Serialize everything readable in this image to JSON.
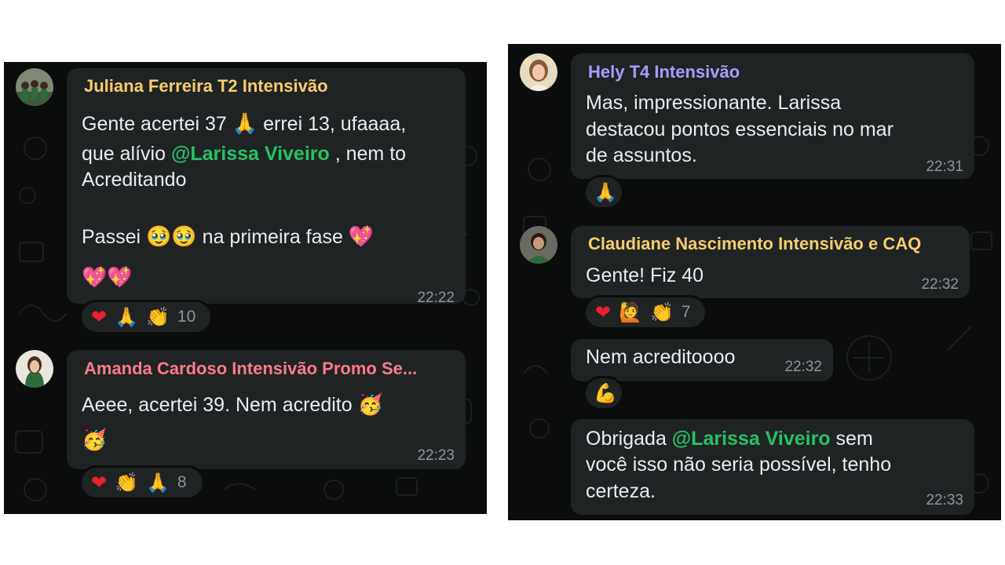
{
  "left_panel": {
    "messages": [
      {
        "sender": "Juliana Ferreira T2 Intensivão",
        "sender_color": "#f8cd6a",
        "line1_a": "Gente acertei 37 ",
        "line1_emoji": "🙏",
        "line1_b": " errei 13,  ufaaaa,",
        "line2_a": "que alívio ",
        "mention": "@Larissa Viveiro",
        "line2_b": " , nem to",
        "line3": "Acreditando",
        "line4_a": "Passei ",
        "line4_emoji": "🥹🥹",
        "line4_b": " na primeira fase ",
        "line4_emoji2": "💖",
        "line5_emoji": "💖💖",
        "time": "22:22",
        "reactions": [
          "❤",
          "🙏",
          "👏"
        ],
        "reaction_count": "10"
      },
      {
        "sender": "Amanda Cardoso Intensivão Promo Se...",
        "sender_color": "#fd7b8a",
        "line1_a": "Aeee, acertei 39. Nem acredito ",
        "line1_emoji": "🥳",
        "line2_emoji": "🥳",
        "time": "22:23",
        "reactions": [
          "❤",
          "👏",
          "🙏"
        ],
        "reaction_count": "8"
      }
    ]
  },
  "right_panel": {
    "messages": [
      {
        "sender": "Hely T4 Intensivão",
        "sender_color": "#a99cff",
        "line1": "Mas, impressionante.  Larissa",
        "line2": "destacou pontos essenciais no mar",
        "line3": "de assuntos.",
        "time": "22:31",
        "reactions": [
          "🙏"
        ]
      },
      {
        "sender": "Claudiane Nascimento Intensivão e CAQ",
        "sender_color": "#f8cd6a",
        "line1": "Gente! Fiz 40",
        "time": "22:32",
        "reactions": [
          "❤",
          "🙋",
          "👏"
        ],
        "reaction_count": "7"
      },
      {
        "line1": "Nem acreditoooo",
        "time": "22:32",
        "reactions": [
          "💪"
        ]
      },
      {
        "line1_a": "Obrigada ",
        "mention": "@Larissa Viveiro",
        "line1_b": " sem",
        "line2": "você isso não seria possível,  tenho",
        "line3": "certeza.",
        "time": "22:33"
      }
    ]
  },
  "colors": {
    "chat_background": "#0b0c0c",
    "bubble": "#202324",
    "mention": "#25c265",
    "timestamp": "#8d9599"
  },
  "icons": [
    "heart-emoji",
    "pray-emoji",
    "clap-emoji",
    "pleading-face-emoji",
    "sparkling-heart-emoji",
    "party-face-emoji",
    "raising-hand-emoji",
    "flexed-biceps-emoji"
  ]
}
